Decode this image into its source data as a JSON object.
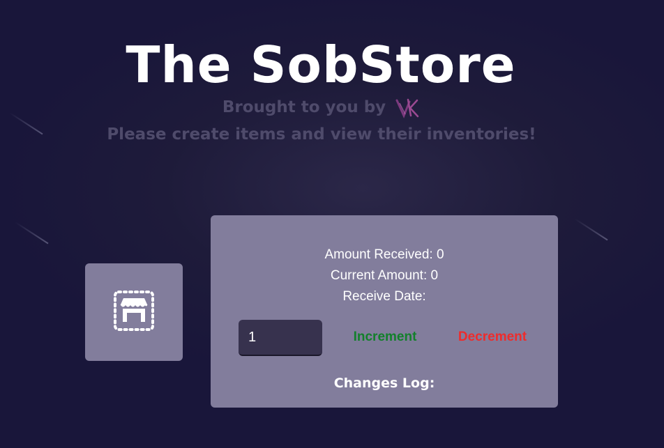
{
  "header": {
    "title": "The SobStore",
    "brought_by": "Brought to you by",
    "logo_icon": "vk-logo-icon",
    "subtitle": "Please create items and view their inventories!"
  },
  "store_card": {
    "icon": "storefront-icon"
  },
  "item_panel": {
    "amount_received": "Amount Received: 0",
    "current_amount": "Current Amount: 0",
    "receive_date": "Receive Date:",
    "quantity_value": "1",
    "increment_label": "Increment",
    "decrement_label": "Decrement",
    "changes_log_label": "Changes Log:"
  },
  "colors": {
    "background": "#1b1838",
    "card": "#827d9c",
    "increment": "#13802b",
    "decrement": "#ee2c2c",
    "muted_text": "#4f4b6b"
  }
}
